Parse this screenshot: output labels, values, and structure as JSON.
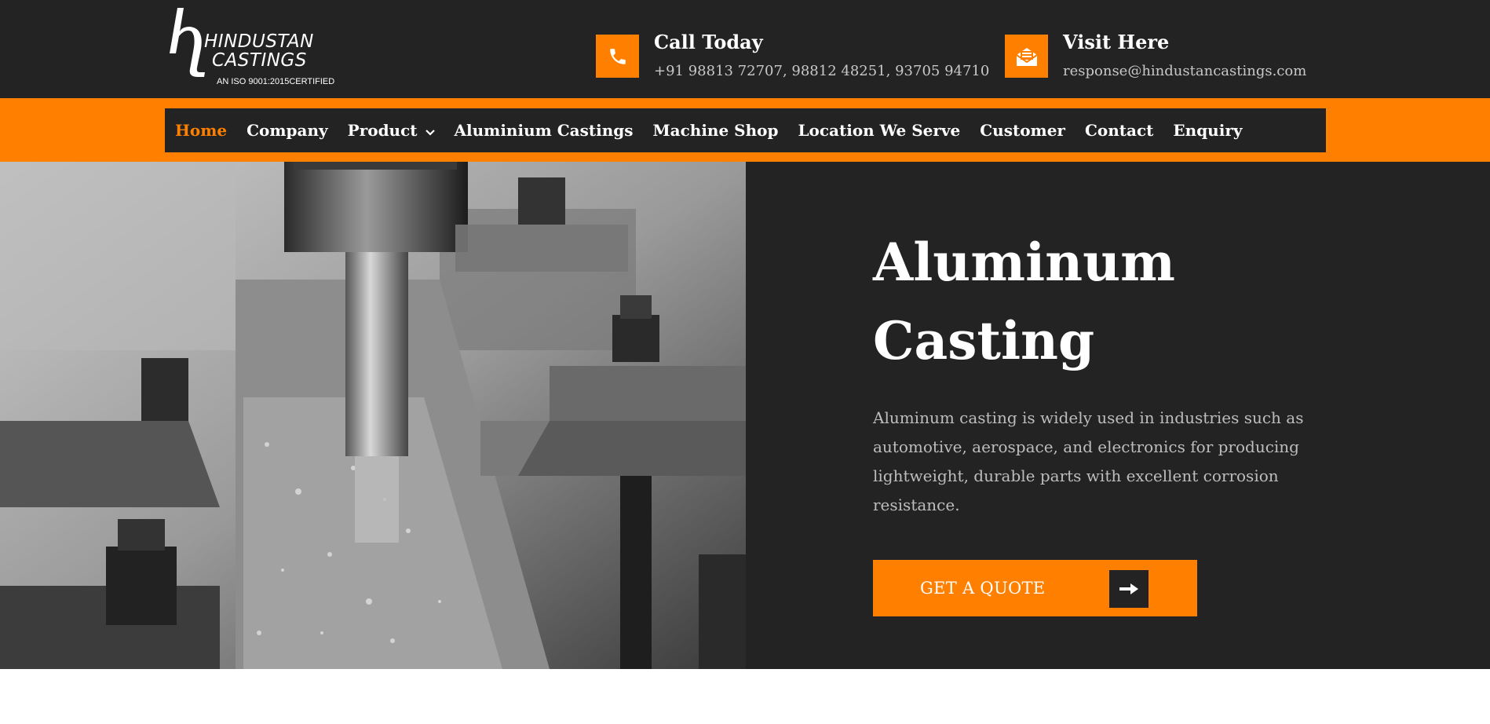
{
  "brand": {
    "line1": "HINDUSTAN",
    "line2": "CASTINGS",
    "cert": "AN ISO 9001:2015CERTIFIED"
  },
  "contacts": {
    "call": {
      "title": "Call Today",
      "detail": "+91 98813 72707, 98812 48251, 93705 94710",
      "icon": "phone-icon"
    },
    "visit": {
      "title": "Visit Here",
      "detail": "response@hindustancastings.com",
      "icon": "mail-icon"
    }
  },
  "nav": {
    "items": [
      {
        "label": "Home"
      },
      {
        "label": "Company"
      },
      {
        "label": "Product"
      },
      {
        "label": "Aluminium Castings"
      },
      {
        "label": "Machine Shop"
      },
      {
        "label": "Location We Serve"
      },
      {
        "label": "Customer"
      },
      {
        "label": "Contact"
      },
      {
        "label": "Enquiry"
      }
    ],
    "active": "Home"
  },
  "hero": {
    "title_line1": "Aluminum",
    "title_line2": "Casting",
    "description": "Aluminum casting is widely used in industries such as automotive, aerospace, and electronics for producing lightweight, durable parts with excellent corrosion resistance.",
    "cta_label": "GET A QUOTE",
    "cta_icon": "arrow-right-icon"
  },
  "colors": {
    "accent": "#ff8000",
    "dark": "#232323",
    "white": "#ffffff"
  }
}
